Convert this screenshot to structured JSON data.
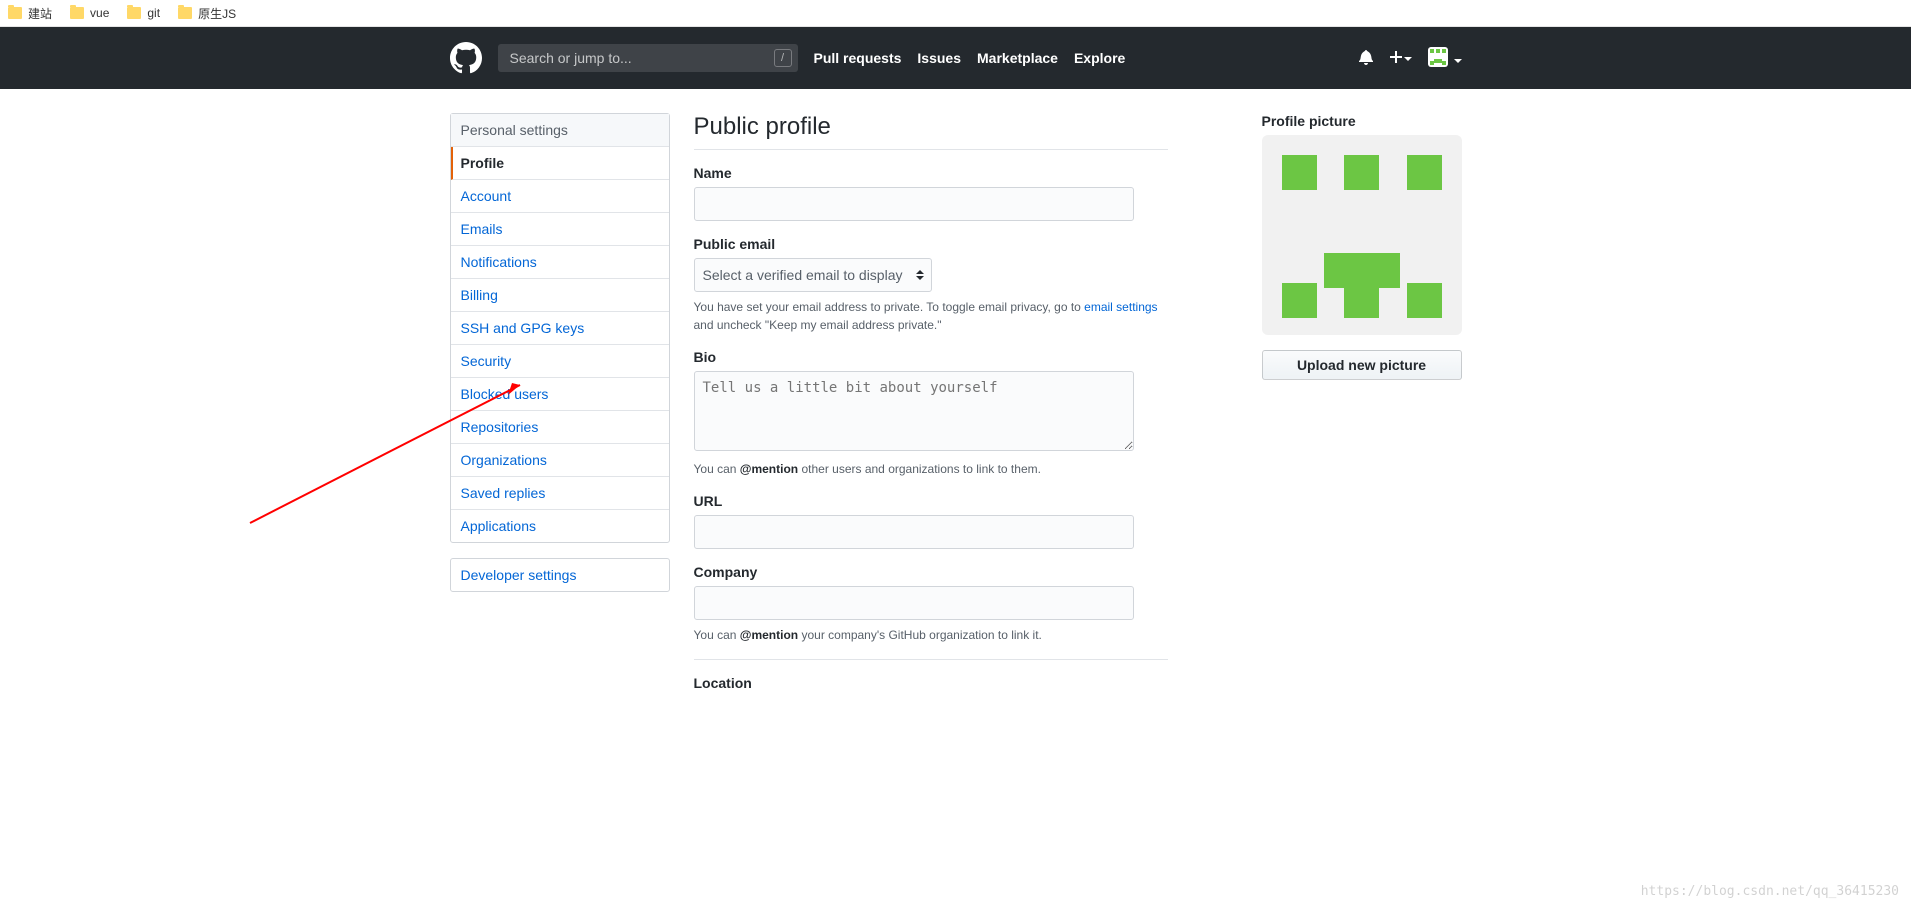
{
  "bookmarks": [
    {
      "label": "建站"
    },
    {
      "label": "vue"
    },
    {
      "label": "git"
    },
    {
      "label": "原生JS"
    }
  ],
  "header": {
    "search_placeholder": "Search or jump to...",
    "slash": "/",
    "nav": {
      "pull_requests": "Pull requests",
      "issues": "Issues",
      "marketplace": "Marketplace",
      "explore": "Explore"
    }
  },
  "sidebar": {
    "heading": "Personal settings",
    "items": [
      {
        "label": "Profile",
        "selected": true
      },
      {
        "label": "Account"
      },
      {
        "label": "Emails"
      },
      {
        "label": "Notifications"
      },
      {
        "label": "Billing"
      },
      {
        "label": "SSH and GPG keys"
      },
      {
        "label": "Security"
      },
      {
        "label": "Blocked users"
      },
      {
        "label": "Repositories"
      },
      {
        "label": "Organizations"
      },
      {
        "label": "Saved replies"
      },
      {
        "label": "Applications"
      }
    ],
    "dev_settings": "Developer settings"
  },
  "page": {
    "title": "Public profile",
    "name_label": "Name",
    "public_email_label": "Public email",
    "email_select_placeholder": "Select a verified email to display",
    "email_note_pre": "You have set your email address to private. To toggle email privacy, go to ",
    "email_settings_link": "email settings",
    "email_note_post": " and uncheck \"Keep my email address private.\"",
    "bio_label": "Bio",
    "bio_placeholder": "Tell us a little bit about yourself",
    "bio_note_pre": "You can ",
    "bio_note_strong": "@mention",
    "bio_note_post": " other users and organizations to link to them.",
    "url_label": "URL",
    "company_label": "Company",
    "company_note_pre": "You can ",
    "company_note_strong": "@mention",
    "company_note_post": " your company's GitHub organization to link it.",
    "location_label": "Location",
    "profile_picture_label": "Profile picture",
    "upload_button": "Upload new picture"
  },
  "watermark": "https://blog.csdn.net/qq_36415230"
}
